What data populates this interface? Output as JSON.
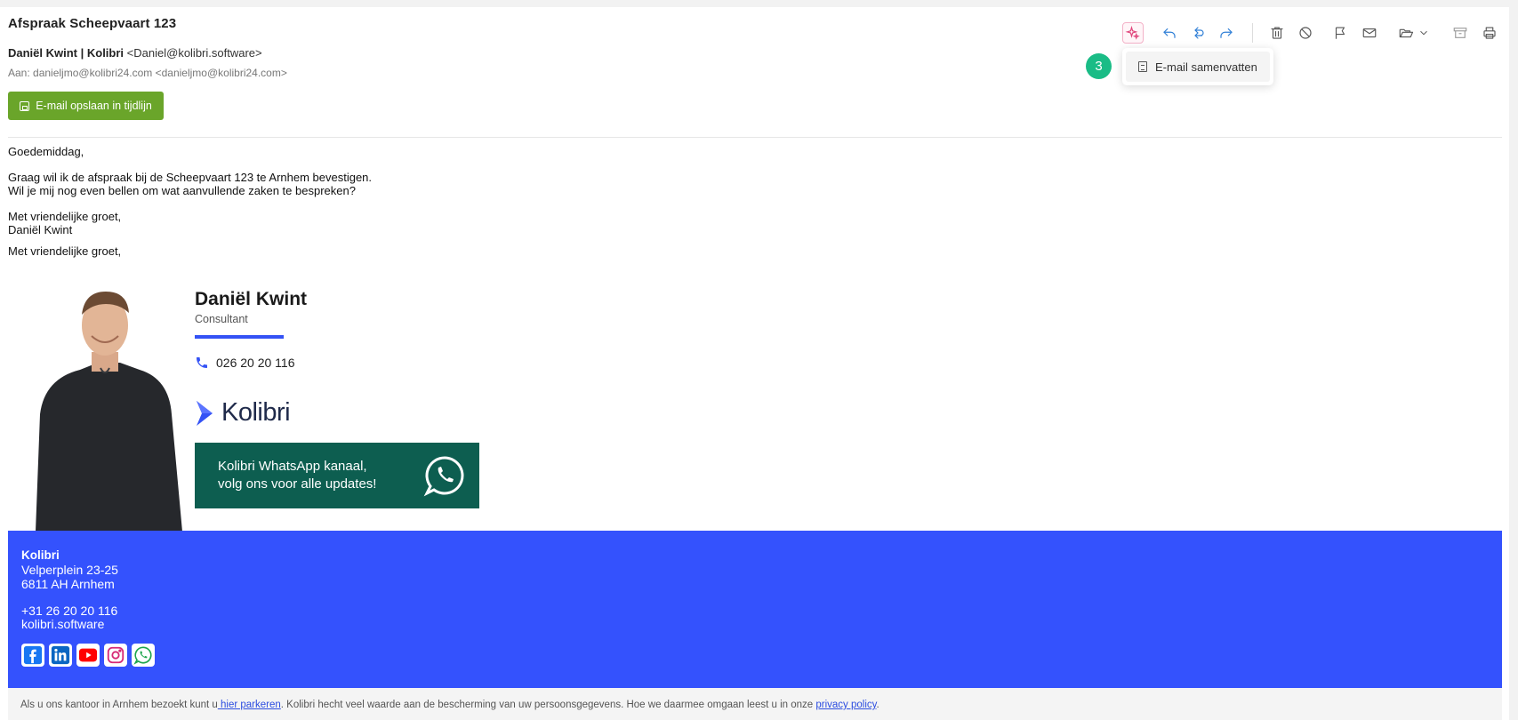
{
  "email": {
    "subject": "Afspraak Scheepvaart 123",
    "sender_name": "Daniël Kwint | Kolibri",
    "sender_email": "<Daniel@kolibri.software>",
    "to_label": "Aan:",
    "to_value": "danieljmo@kolibri24.com <danieljmo@kolibri24.com>",
    "save_button": "E-mail opslaan in tijdlijn",
    "body": {
      "greeting": "Goedemiddag,",
      "line1": "Graag wil ik de afspraak bij de Scheepvaart 123 te Arnhem bevestigen.",
      "line2": "Wil je mij nog even bellen om wat aanvullende zaken te bespreken?",
      "closing1": "Met vriendelijke groet,",
      "closing_name": "Daniël Kwint",
      "closing2": "Met vriendelijke groet,"
    }
  },
  "toolbar": {
    "icons": [
      "ai-sparkle-icon",
      "reply-icon",
      "reply-all-icon",
      "forward-icon",
      "trash-icon",
      "block-icon",
      "flag-icon",
      "mail-icon",
      "folder-move-icon",
      "archive-icon",
      "print-icon"
    ]
  },
  "dropdown": {
    "item_label": "E-mail samenvatten",
    "step_number": "3"
  },
  "signature": {
    "name": "Daniël Kwint",
    "role": "Consultant",
    "phone": "026 20 20 116",
    "logo_text": "Kolibri",
    "whatsapp_line1": "Kolibri WhatsApp kanaal,",
    "whatsapp_line2": "volg ons voor alle updates!"
  },
  "footer": {
    "company": "Kolibri",
    "address1": "Velperplein 23-25",
    "address2": "6811 AH Arnhem",
    "phone": "+31 26 20 20 116",
    "website": "kolibri.software",
    "social": [
      "facebook-icon",
      "linkedin-icon",
      "youtube-icon",
      "instagram-icon",
      "whatsapp-icon"
    ]
  },
  "disclaimer": {
    "part1": "Als u ons kantoor in Arnhem bezoekt kunt u",
    "link1": " hier parkeren",
    "part2": ". Kolibri hecht veel waarde aan de bescherming van uw persoonsgegevens. Hoe we daarmee omgaan leest u in onze ",
    "link2": "privacy policy",
    "part3": "."
  },
  "colors": {
    "accent_blue": "#3452fd",
    "save_green": "#6aa52a",
    "badge_green": "#1abc86",
    "whatsapp_banner": "#0d5e50",
    "reply_blue": "#2f7fd6"
  }
}
